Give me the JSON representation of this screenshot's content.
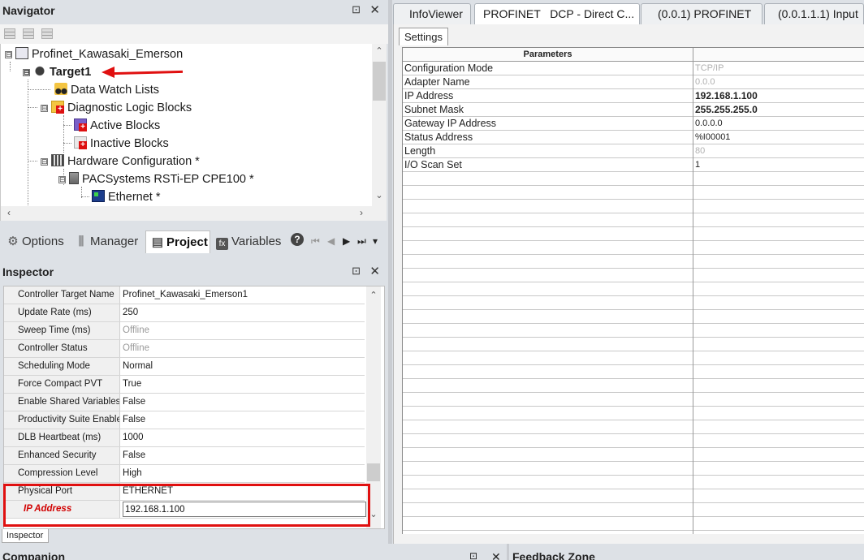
{
  "navigator": {
    "title": "Navigator",
    "pin_glyph": "⊡",
    "close_glyph": "✕",
    "tree": [
      {
        "label": "Profinet_Kawasaki_Emerson",
        "icon": "project-icon",
        "expander": "⊟"
      },
      {
        "label": "Target1",
        "icon": "target-icon",
        "expander": "⊟"
      },
      {
        "label": "Data Watch Lists",
        "icon": "watch-list-icon"
      },
      {
        "label": "Diagnostic Logic Blocks",
        "icon": "diagnostic-blocks-icon",
        "expander": "⊟"
      },
      {
        "label": "Active Blocks",
        "icon": "active-blocks-icon"
      },
      {
        "label": "Inactive Blocks",
        "icon": "inactive-blocks-icon"
      },
      {
        "label": "Hardware Configuration *",
        "icon": "hardware-config-icon",
        "expander": "⊟"
      },
      {
        "label": "PACSystems RSTi-EP CPE100 *",
        "icon": "cpu-icon",
        "expander": "⊟"
      },
      {
        "label": "Ethernet *",
        "icon": "ethernet-icon"
      }
    ],
    "tabs": [
      {
        "label": "Options",
        "glyph": "⚙"
      },
      {
        "label": "Manager",
        "glyph": "⫼"
      },
      {
        "label": "Project",
        "glyph": "▤"
      },
      {
        "label": "Variables",
        "glyph": "fx"
      }
    ],
    "help_glyph": "?",
    "nav_glyphs": [
      "⏮",
      "◀",
      "▶",
      "⏭",
      "▾"
    ]
  },
  "inspector": {
    "title": "Inspector",
    "tab_label": "Inspector",
    "rows": [
      {
        "key": "Controller Target Name",
        "value": "Profinet_Kawasaki_Emerson1"
      },
      {
        "key": "Update Rate (ms)",
        "value": "250"
      },
      {
        "key": "Sweep Time (ms)",
        "value": "Offline"
      },
      {
        "key": "Controller Status",
        "value": "Offline"
      },
      {
        "key": "Scheduling Mode",
        "value": "Normal"
      },
      {
        "key": "Force Compact PVT",
        "value": "True"
      },
      {
        "key": "Enable Shared Variables",
        "value": "False"
      },
      {
        "key": "Productivity Suite Enabled",
        "value": "False"
      },
      {
        "key": "DLB Heartbeat (ms)",
        "value": "1000"
      },
      {
        "key": "Enhanced Security",
        "value": "False"
      },
      {
        "key": "Compression Level",
        "value": "High"
      },
      {
        "key": "Physical Port",
        "value": "ETHERNET"
      }
    ],
    "ip_row": {
      "key": "IP Address",
      "value": "192.168.1.100"
    }
  },
  "document_tabs": [
    {
      "label": "InfoViewer"
    },
    {
      "label": "PROFINET   DCP - Direct C..."
    },
    {
      "label": "(0.0.1) PROFINET"
    },
    {
      "label": "(0.0.1.1.1) Input"
    }
  ],
  "settings": {
    "tab_label": "Settings",
    "header": "Parameters",
    "rows": [
      {
        "key": "Configuration Mode",
        "value": "TCP/IP"
      },
      {
        "key": "Adapter Name",
        "value": "0.0.0"
      },
      {
        "key": "IP Address",
        "value": "192.168.1.100"
      },
      {
        "key": "Subnet Mask",
        "value": "255.255.255.0"
      },
      {
        "key": "Gateway IP Address",
        "value": "0.0.0.0"
      },
      {
        "key": "Status Address",
        "value": "%I00001"
      },
      {
        "key": "Length",
        "value": "80"
      },
      {
        "key": "I/O Scan Set",
        "value": "1"
      }
    ]
  },
  "bottom": {
    "companion_title": "Companion",
    "feedback_title": "Feedback Zone"
  }
}
